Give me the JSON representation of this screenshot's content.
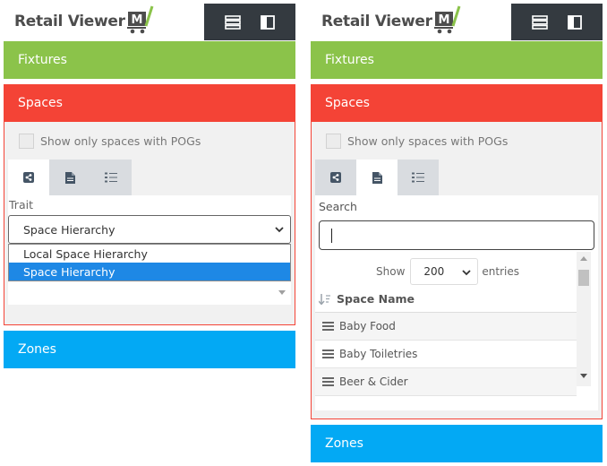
{
  "app": {
    "logo_text": "Retail Viewer"
  },
  "toolbar": {
    "list_icon": "list-view-icon",
    "panel_icon": "panel-toggle-icon"
  },
  "left": {
    "fixtures_label": "Fixtures",
    "spaces_label": "Spaces",
    "checkbox_label": "Show only spaces with POGs",
    "tabs": [
      "hierarchy-tab",
      "document-tab",
      "checklist-tab"
    ],
    "active_tab": 0,
    "trait_label": "Trait",
    "select_value": "Space Hierarchy",
    "dropdown_options": [
      "Local Space Hierarchy",
      "Space Hierarchy"
    ],
    "selected_option": "Space Hierarchy",
    "zones_label": "Zones"
  },
  "right": {
    "fixtures_label": "Fixtures",
    "spaces_label": "Spaces",
    "checkbox_label": "Show only spaces with POGs",
    "active_tab": 1,
    "search_label": "Search",
    "search_value": "",
    "show_label": "Show",
    "entries_value": "200",
    "entries_label": "entries",
    "column_header": "Space Name",
    "rows": [
      "Baby Food",
      "Baby Toiletries",
      "Beer & Cider"
    ],
    "zones_label": "Zones"
  },
  "colors": {
    "fixtures": "#8bc34a",
    "spaces": "#f44336",
    "zones": "#03a9f4",
    "toolbar": "#343a40",
    "selection": "#1e88e5"
  }
}
